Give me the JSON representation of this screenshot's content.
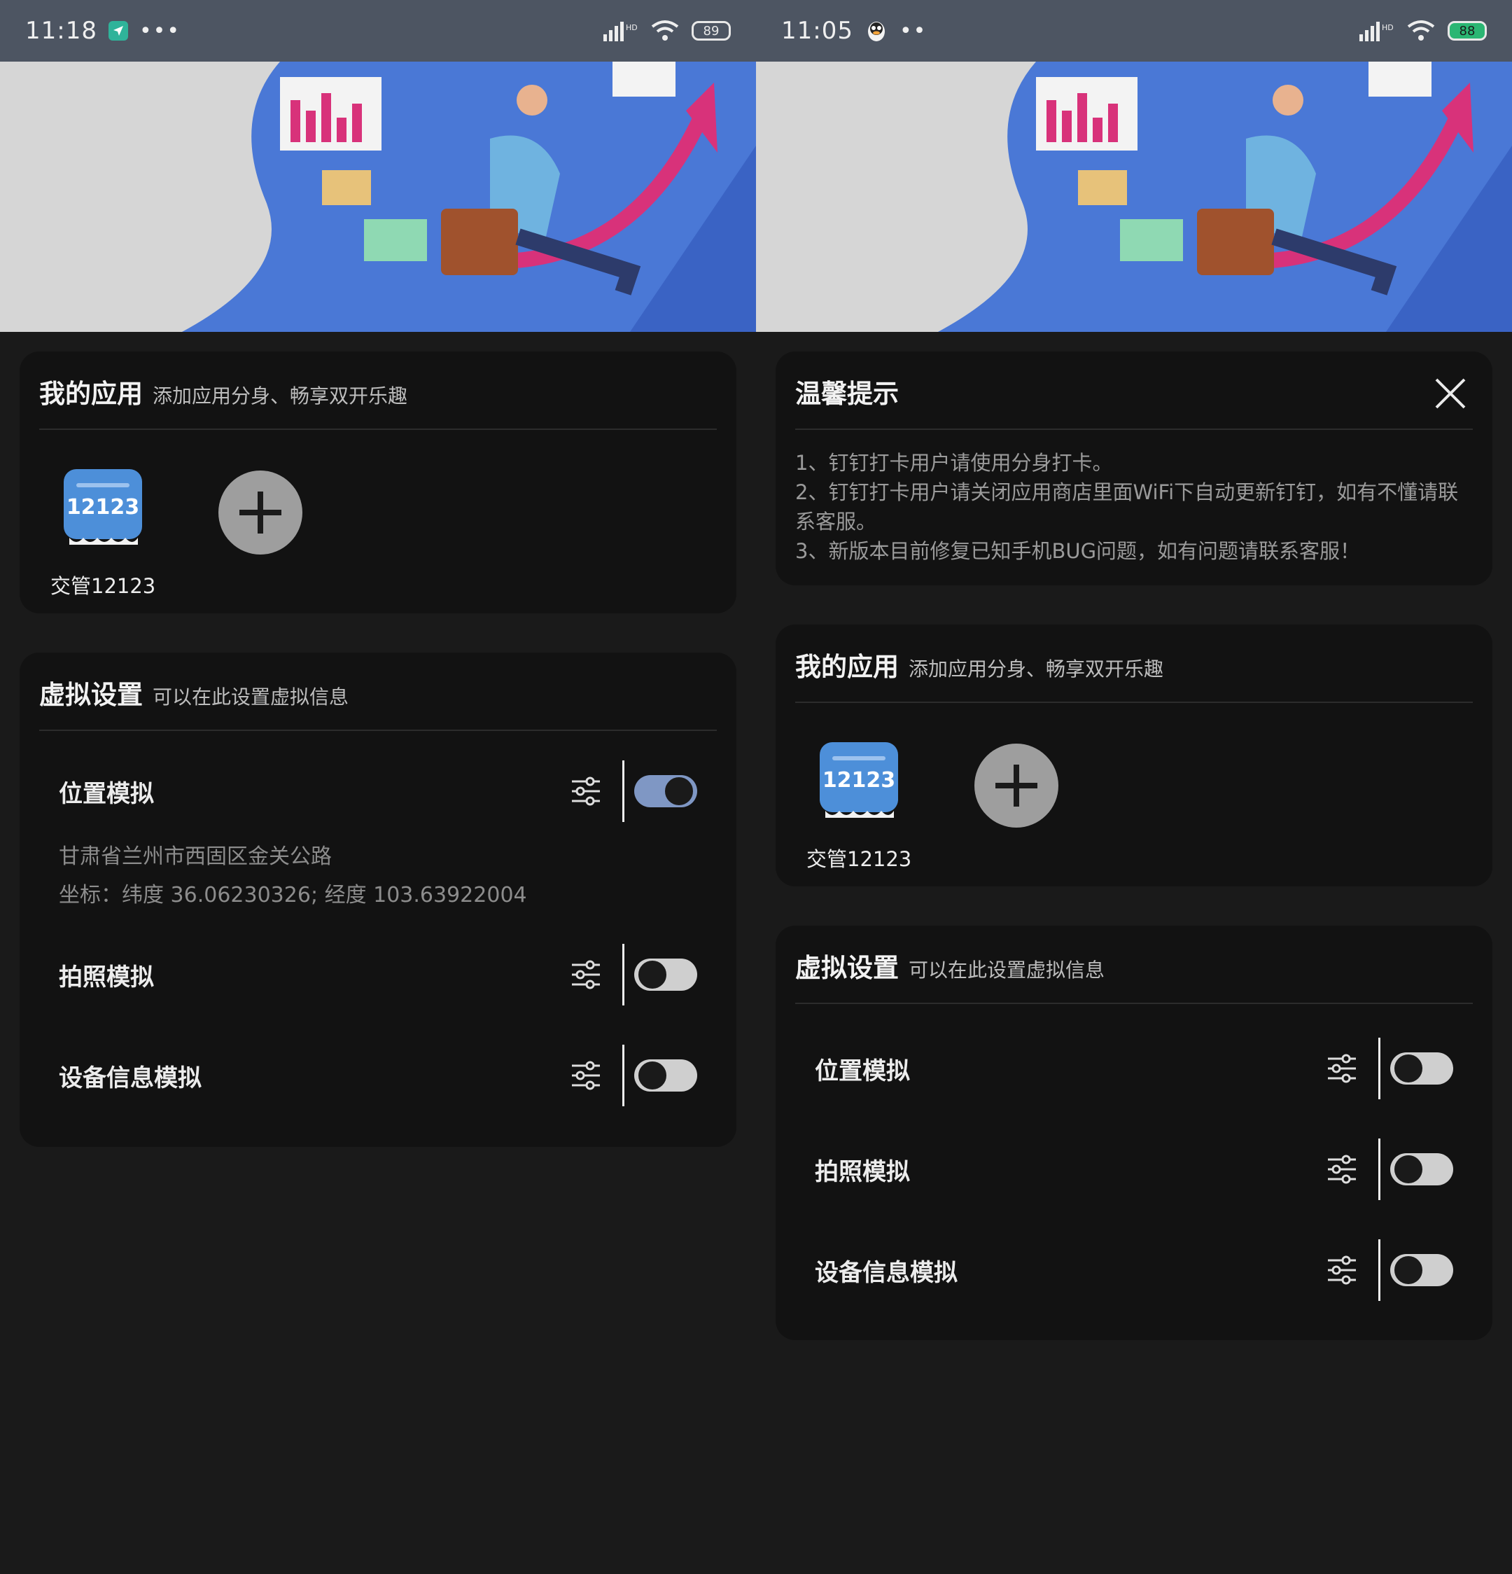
{
  "left": {
    "status": {
      "time": "11:18",
      "dots": "•••",
      "battery": "89"
    },
    "apps_card": {
      "title": "我的应用",
      "subtitle": "添加应用分身、畅享双开乐趣",
      "app_name": "交管12123",
      "app_icon_text": "12123"
    },
    "virtual_card": {
      "title": "虚拟设置",
      "subtitle": "可以在此设置虚拟信息",
      "rows": [
        {
          "label": "位置模拟",
          "on": true,
          "address": "甘肃省兰州市西固区金关公路",
          "coords": "坐标：纬度 36.06230326; 经度 103.63922004"
        },
        {
          "label": "拍照模拟",
          "on": false
        },
        {
          "label": "设备信息模拟",
          "on": false
        }
      ]
    }
  },
  "right": {
    "status": {
      "time": "11:05",
      "dots": "••",
      "battery": "88"
    },
    "tips_card": {
      "title": "温馨提示",
      "lines": [
        "1、钉钉打卡用户请使用分身打卡。",
        "2、钉钉打卡用户请关闭应用商店里面WiFi下自动更新钉钉，如有不懂请联系客服。",
        "3、新版本目前修复已知手机BUG问题，如有问题请联系客服！"
      ]
    },
    "apps_card": {
      "title": "我的应用",
      "subtitle": "添加应用分身、畅享双开乐趣",
      "app_name": "交管12123",
      "app_icon_text": "12123"
    },
    "virtual_card": {
      "title": "虚拟设置",
      "subtitle": "可以在此设置虚拟信息",
      "rows": [
        {
          "label": "位置模拟",
          "on": false
        },
        {
          "label": "拍照模拟",
          "on": false
        },
        {
          "label": "设备信息模拟",
          "on": false
        }
      ]
    }
  },
  "colors": {
    "background": "#1a1a1a",
    "card": "#121212",
    "statusbar": "#4d5562",
    "toggle_on": "#7f97c4",
    "banner_blue": "#4a78d6",
    "accent_pink": "#d8327a"
  },
  "icons": [
    "location-arrow-icon",
    "penguin-icon",
    "signal-icon",
    "wifi-icon",
    "battery-icon",
    "plus-icon",
    "close-icon",
    "adjust-sliders-icon"
  ]
}
